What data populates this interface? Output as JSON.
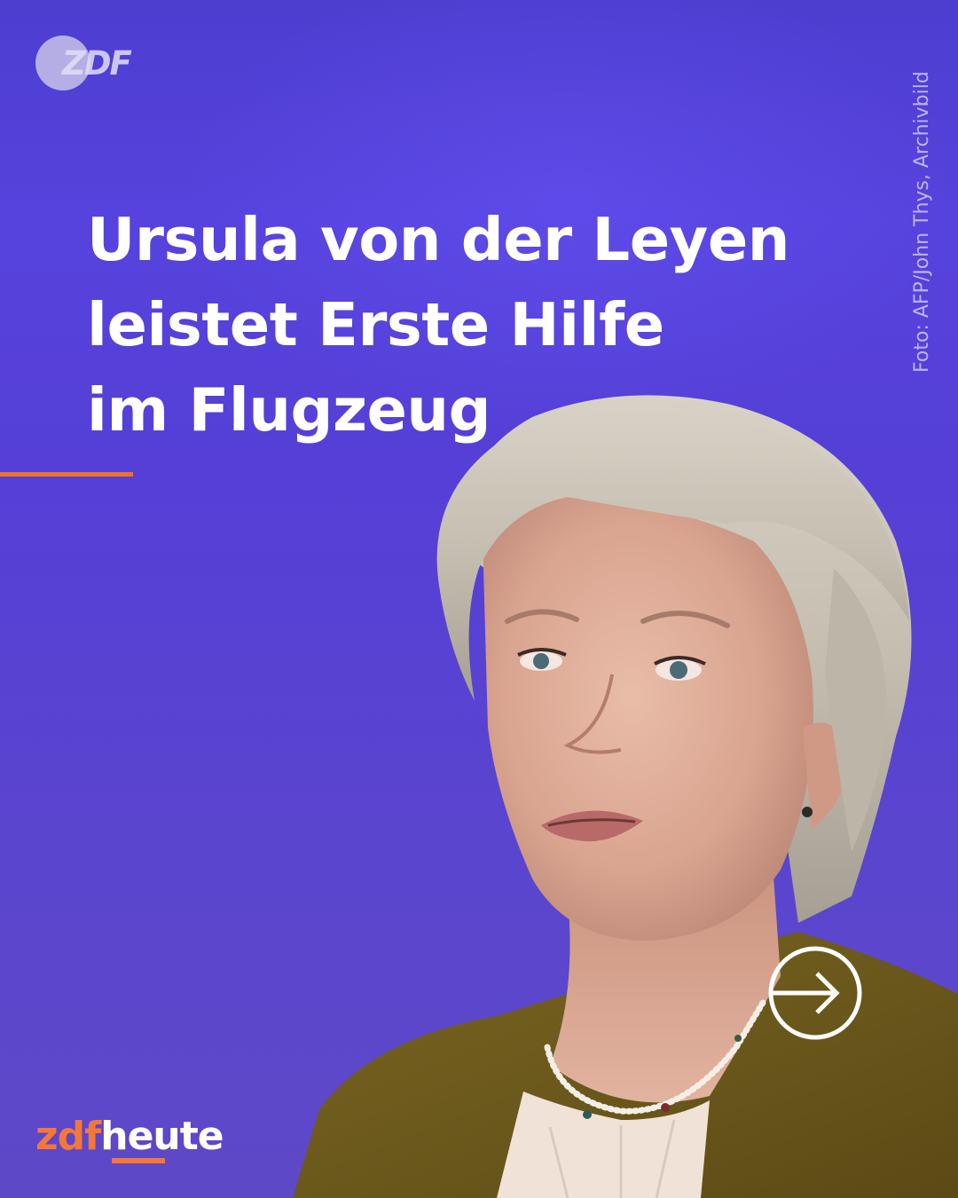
{
  "logo_top": {
    "text": "ZDF",
    "icon": "zdf-logo"
  },
  "credit": "Foto: AFP/John Thys, Archivbild",
  "headline": {
    "line1": "Ursula von der Leyen",
    "line2": "leistet Erste Hilfe",
    "line3": "im Flugzeug"
  },
  "brand": {
    "part1": "zdf",
    "part2": "heute"
  },
  "arrow_button": {
    "icon": "arrow-right-circle-icon"
  },
  "colors": {
    "background": "#5542d8",
    "accent": "#f0702a",
    "text": "#ffffff",
    "jacket": "#6b5a1c"
  }
}
